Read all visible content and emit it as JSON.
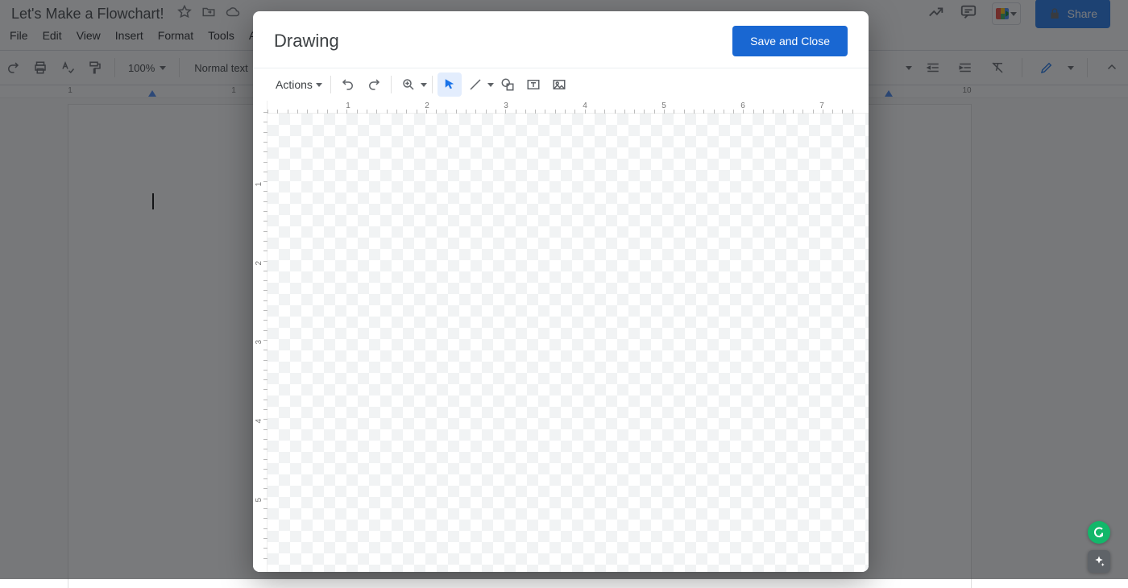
{
  "doc": {
    "title": "Let's Make a Flowchart!",
    "menus": [
      "File",
      "Edit",
      "View",
      "Insert",
      "Format",
      "Tools",
      "A"
    ],
    "zoom": "100%",
    "paragraph_style": "Normal text",
    "share_label": "Share",
    "h_ruler_marks": [
      "1",
      "1"
    ]
  },
  "right_tools": {
    "toolbar_right_marks": [
      "10"
    ]
  },
  "dialog": {
    "title": "Drawing",
    "save_label": "Save and Close",
    "actions_label": "Actions",
    "h_ruler": [
      "1",
      "2",
      "3",
      "4",
      "5",
      "6",
      "7"
    ],
    "v_ruler": [
      "1",
      "2",
      "3",
      "4",
      "5"
    ]
  },
  "icons": {
    "star": "star-icon",
    "move": "folder-move-icon",
    "cloud": "cloud-status-icon",
    "trend": "trend-icon",
    "comment": "comments-icon",
    "meet": "meet-icon",
    "lock": "lock-icon",
    "undo": "undo-icon",
    "redo": "redo-icon",
    "print": "print-icon",
    "spellcheck": "spellcheck-icon",
    "paint": "paint-format-icon",
    "chevron": "chevron-down-icon",
    "select": "select-tool-icon",
    "line": "line-tool-icon",
    "shape": "shape-tool-icon",
    "textbox": "textbox-tool-icon",
    "image": "image-tool-icon",
    "zoomin": "zoom-tool-icon",
    "indent_dec": "decrease-indent-icon",
    "indent_inc": "increase-indent-icon",
    "clear": "clear-format-icon",
    "pen": "editing-mode-icon",
    "collapse": "collapse-icon"
  }
}
